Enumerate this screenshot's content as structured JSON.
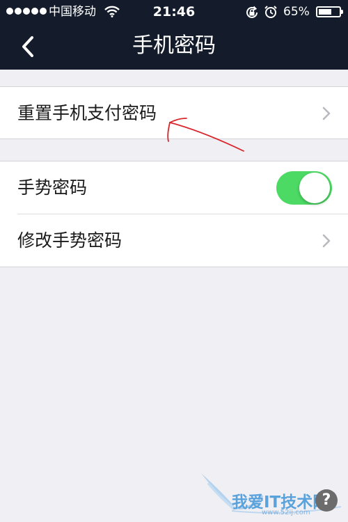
{
  "status_bar": {
    "carrier": "中国移动",
    "time": "21:46",
    "battery": "65%",
    "battery_level": 0.65
  },
  "nav": {
    "title": "手机密码"
  },
  "settings": {
    "reset_pay_password": "重置手机支付密码",
    "gesture_password": "手势密码",
    "gesture_enabled": true,
    "change_gesture_password": "修改手势密码"
  },
  "watermark": {
    "text": "我爱IT技术网",
    "url": "www.52ij.com",
    "help_glyph": "?"
  },
  "colors": {
    "nav_bg": "#141c2b",
    "page_bg": "#efeff4",
    "toggle_on": "#4cd964",
    "annotation": "#d9252b"
  }
}
